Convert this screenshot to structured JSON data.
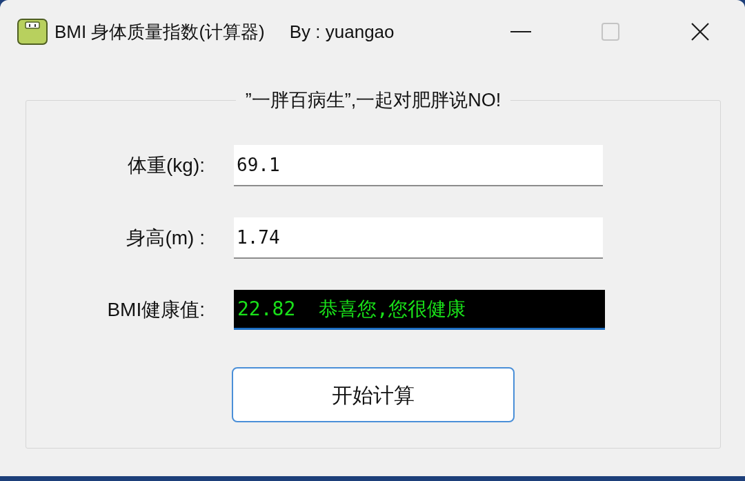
{
  "window": {
    "title": "BMI 身体质量指数(计算器)",
    "author": "By : yuangao",
    "controls": [
      {
        "kind": "minimize",
        "disabled": false
      },
      {
        "kind": "maximize",
        "disabled": true
      },
      {
        "kind": "close",
        "disabled": false
      }
    ]
  },
  "group": {
    "legend": "”一胖百病生”,一起对肥胖说NO!",
    "fields": [
      {
        "kind": "input",
        "label": "体重(kg):",
        "value": "69.1",
        "focused": false
      },
      {
        "kind": "input",
        "label": "身高(m) :",
        "value": "1.74",
        "focused": false
      },
      {
        "kind": "output",
        "label": "BMI健康值:",
        "value": "22.82  恭喜您,您很健康",
        "focused": true
      }
    ]
  },
  "button": {
    "label": "开始计算"
  }
}
